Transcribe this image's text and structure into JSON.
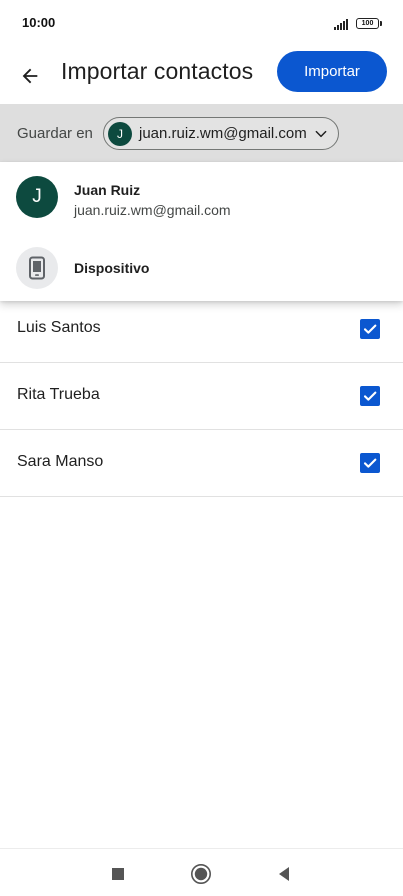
{
  "status": {
    "time": "10:00",
    "battery": "100"
  },
  "header": {
    "title": "Importar contactos",
    "import_label": "Importar",
    "back_icon": "arrow-back-icon"
  },
  "save_in": {
    "label": "Guardar en",
    "account_initial": "J",
    "account_email": "juan.ruiz.wm@gmail.com"
  },
  "dropdown": {
    "items": [
      {
        "initial": "J",
        "name": "Juan Ruiz",
        "email": "juan.ruiz.wm@gmail.com",
        "icon": "account-avatar"
      },
      {
        "name": "Dispositivo",
        "icon": "phone-device-icon"
      }
    ]
  },
  "contacts": [
    {
      "name": "Luis Santos",
      "checked": true
    },
    {
      "name": "Rita Trueba",
      "checked": true
    },
    {
      "name": "Sara Manso",
      "checked": true
    }
  ],
  "colors": {
    "primary": "#0b57d0",
    "avatar": "#0d4a3f",
    "save_bar": "#dedede"
  },
  "nav": {
    "icons": [
      "recents-square-icon",
      "home-circle-icon",
      "back-triangle-icon"
    ]
  }
}
